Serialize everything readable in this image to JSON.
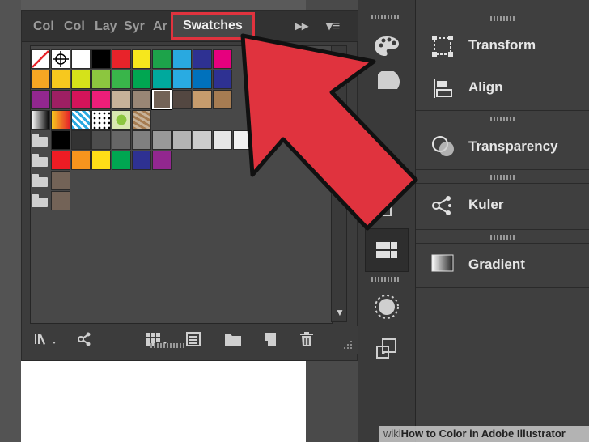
{
  "swatches_panel": {
    "tabs": [
      "Col",
      "Col",
      "Lay",
      "Syr",
      "Ar"
    ],
    "active_tab": "Swatches",
    "tab_controls": {
      "collapse": "▸▸",
      "menu": "▾≡"
    },
    "rows": [
      [
        "none",
        "register",
        "#ffffff",
        "#000000",
        "#e8232a",
        "#f6e71d",
        "#1da34a",
        "#29a9e0",
        "#2e3192",
        "#e6007e"
      ],
      [
        "#f5a623",
        "#f7c81e",
        "#d5e21a",
        "#8cc63f",
        "#39b54a",
        "#00a651",
        "#00a99d",
        "#29abe2",
        "#0071bc",
        "#2e3192"
      ],
      [
        "#92278f",
        "#9e1f63",
        "#d4145a",
        "#ed1e79",
        "#c7b299",
        "#998675",
        "#736357",
        "#534741",
        "#c69c6d",
        "#a67c52"
      ],
      [
        "gradient-gray",
        "gradient-orange",
        "gradient-blue",
        "pattern-dots",
        "pattern-leaf",
        "pattern-stone"
      ],
      [
        "folder",
        "#000000",
        "#333333",
        "#4d4d4d",
        "#666666",
        "#808080",
        "#999999",
        "#b3b3b3",
        "#cccccc",
        "#e6e6e6",
        "#f2f2f2"
      ],
      [
        "folder",
        "#ed1c24",
        "#f7941d",
        "#ffde17",
        "#00a651",
        "#2e3192",
        "#92278f"
      ],
      [
        "folder",
        "#736357"
      ],
      [
        "folder",
        "#736357"
      ]
    ],
    "bottom_icons": [
      "swatch-libraries-icon",
      "show-kinds-icon",
      "swatch-options-icon",
      "color-group-icon",
      "new-group-icon",
      "new-swatch-icon",
      "delete-icon"
    ]
  },
  "tool_strip": {
    "buttons": [
      "palette-icon",
      "color-guide-icon",
      "brush-icon",
      "symbols-icon",
      "swatches-grid-icon",
      "appearance-icon",
      "artboards-icon"
    ]
  },
  "right_panel": {
    "items": [
      {
        "label": "Transform",
        "icon": "transform-icon"
      },
      {
        "label": "Align",
        "icon": "align-icon"
      },
      {
        "label": "Transparency",
        "icon": "transparency-icon"
      },
      {
        "label": "Kuler",
        "icon": "kuler-icon"
      },
      {
        "label": "Gradient",
        "icon": "gradient-icon"
      }
    ]
  },
  "annotation": {
    "arrow_color": "#e0333e"
  },
  "watermark": {
    "brand": "wiki",
    "text": "How to Color in Adobe Illustrator"
  }
}
